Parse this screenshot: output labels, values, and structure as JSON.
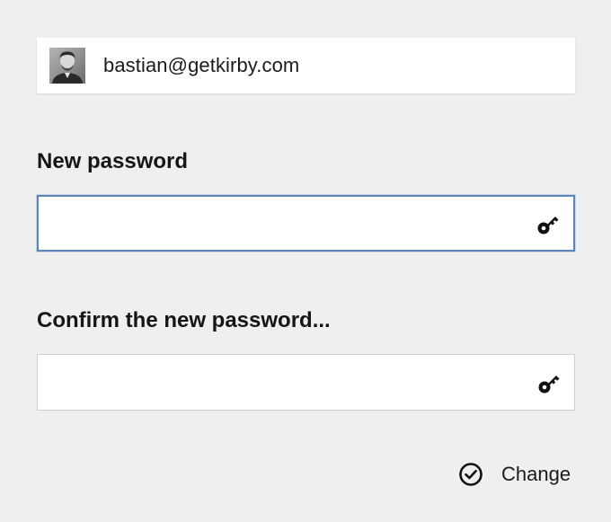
{
  "user": {
    "email": "bastian@getkirby.com",
    "avatar_icon": "user-photo"
  },
  "fields": {
    "new_password": {
      "label": "New password",
      "value": "",
      "placeholder": "",
      "icon": "key-icon"
    },
    "confirm_password": {
      "label": "Confirm the new password...",
      "value": "",
      "placeholder": "",
      "icon": "key-icon"
    }
  },
  "actions": {
    "change_label": "Change",
    "change_icon": "check-circle-icon"
  },
  "colors": {
    "background": "#efefef",
    "focus_border": "#5b86bd",
    "text": "#1b1b1b"
  }
}
